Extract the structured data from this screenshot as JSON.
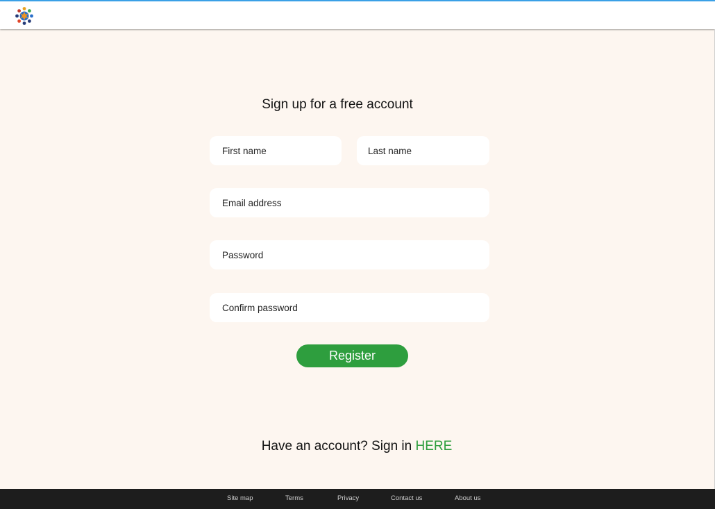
{
  "form": {
    "title": "Sign up for a free account",
    "fields": {
      "first_name": {
        "placeholder": "First name",
        "value": ""
      },
      "last_name": {
        "placeholder": "Last name",
        "value": ""
      },
      "email": {
        "placeholder": "Email address",
        "value": ""
      },
      "password": {
        "placeholder": "Password",
        "value": ""
      },
      "confirm_password": {
        "placeholder": "Confirm password",
        "value": ""
      }
    },
    "register_label": "Register"
  },
  "signin": {
    "prompt": "Have an account? Sign in ",
    "link_label": "HERE"
  },
  "footer": {
    "links": [
      "Site map",
      "Terms",
      "Privacy",
      "Contact us",
      "About us"
    ]
  },
  "logo": {
    "icon": "colorful-people-circle-logo"
  },
  "colors": {
    "accent": "#2e9e3e",
    "background": "#fdf6f0",
    "footer": "#1d1d1d",
    "topbar_border": "#3aa0e6"
  }
}
